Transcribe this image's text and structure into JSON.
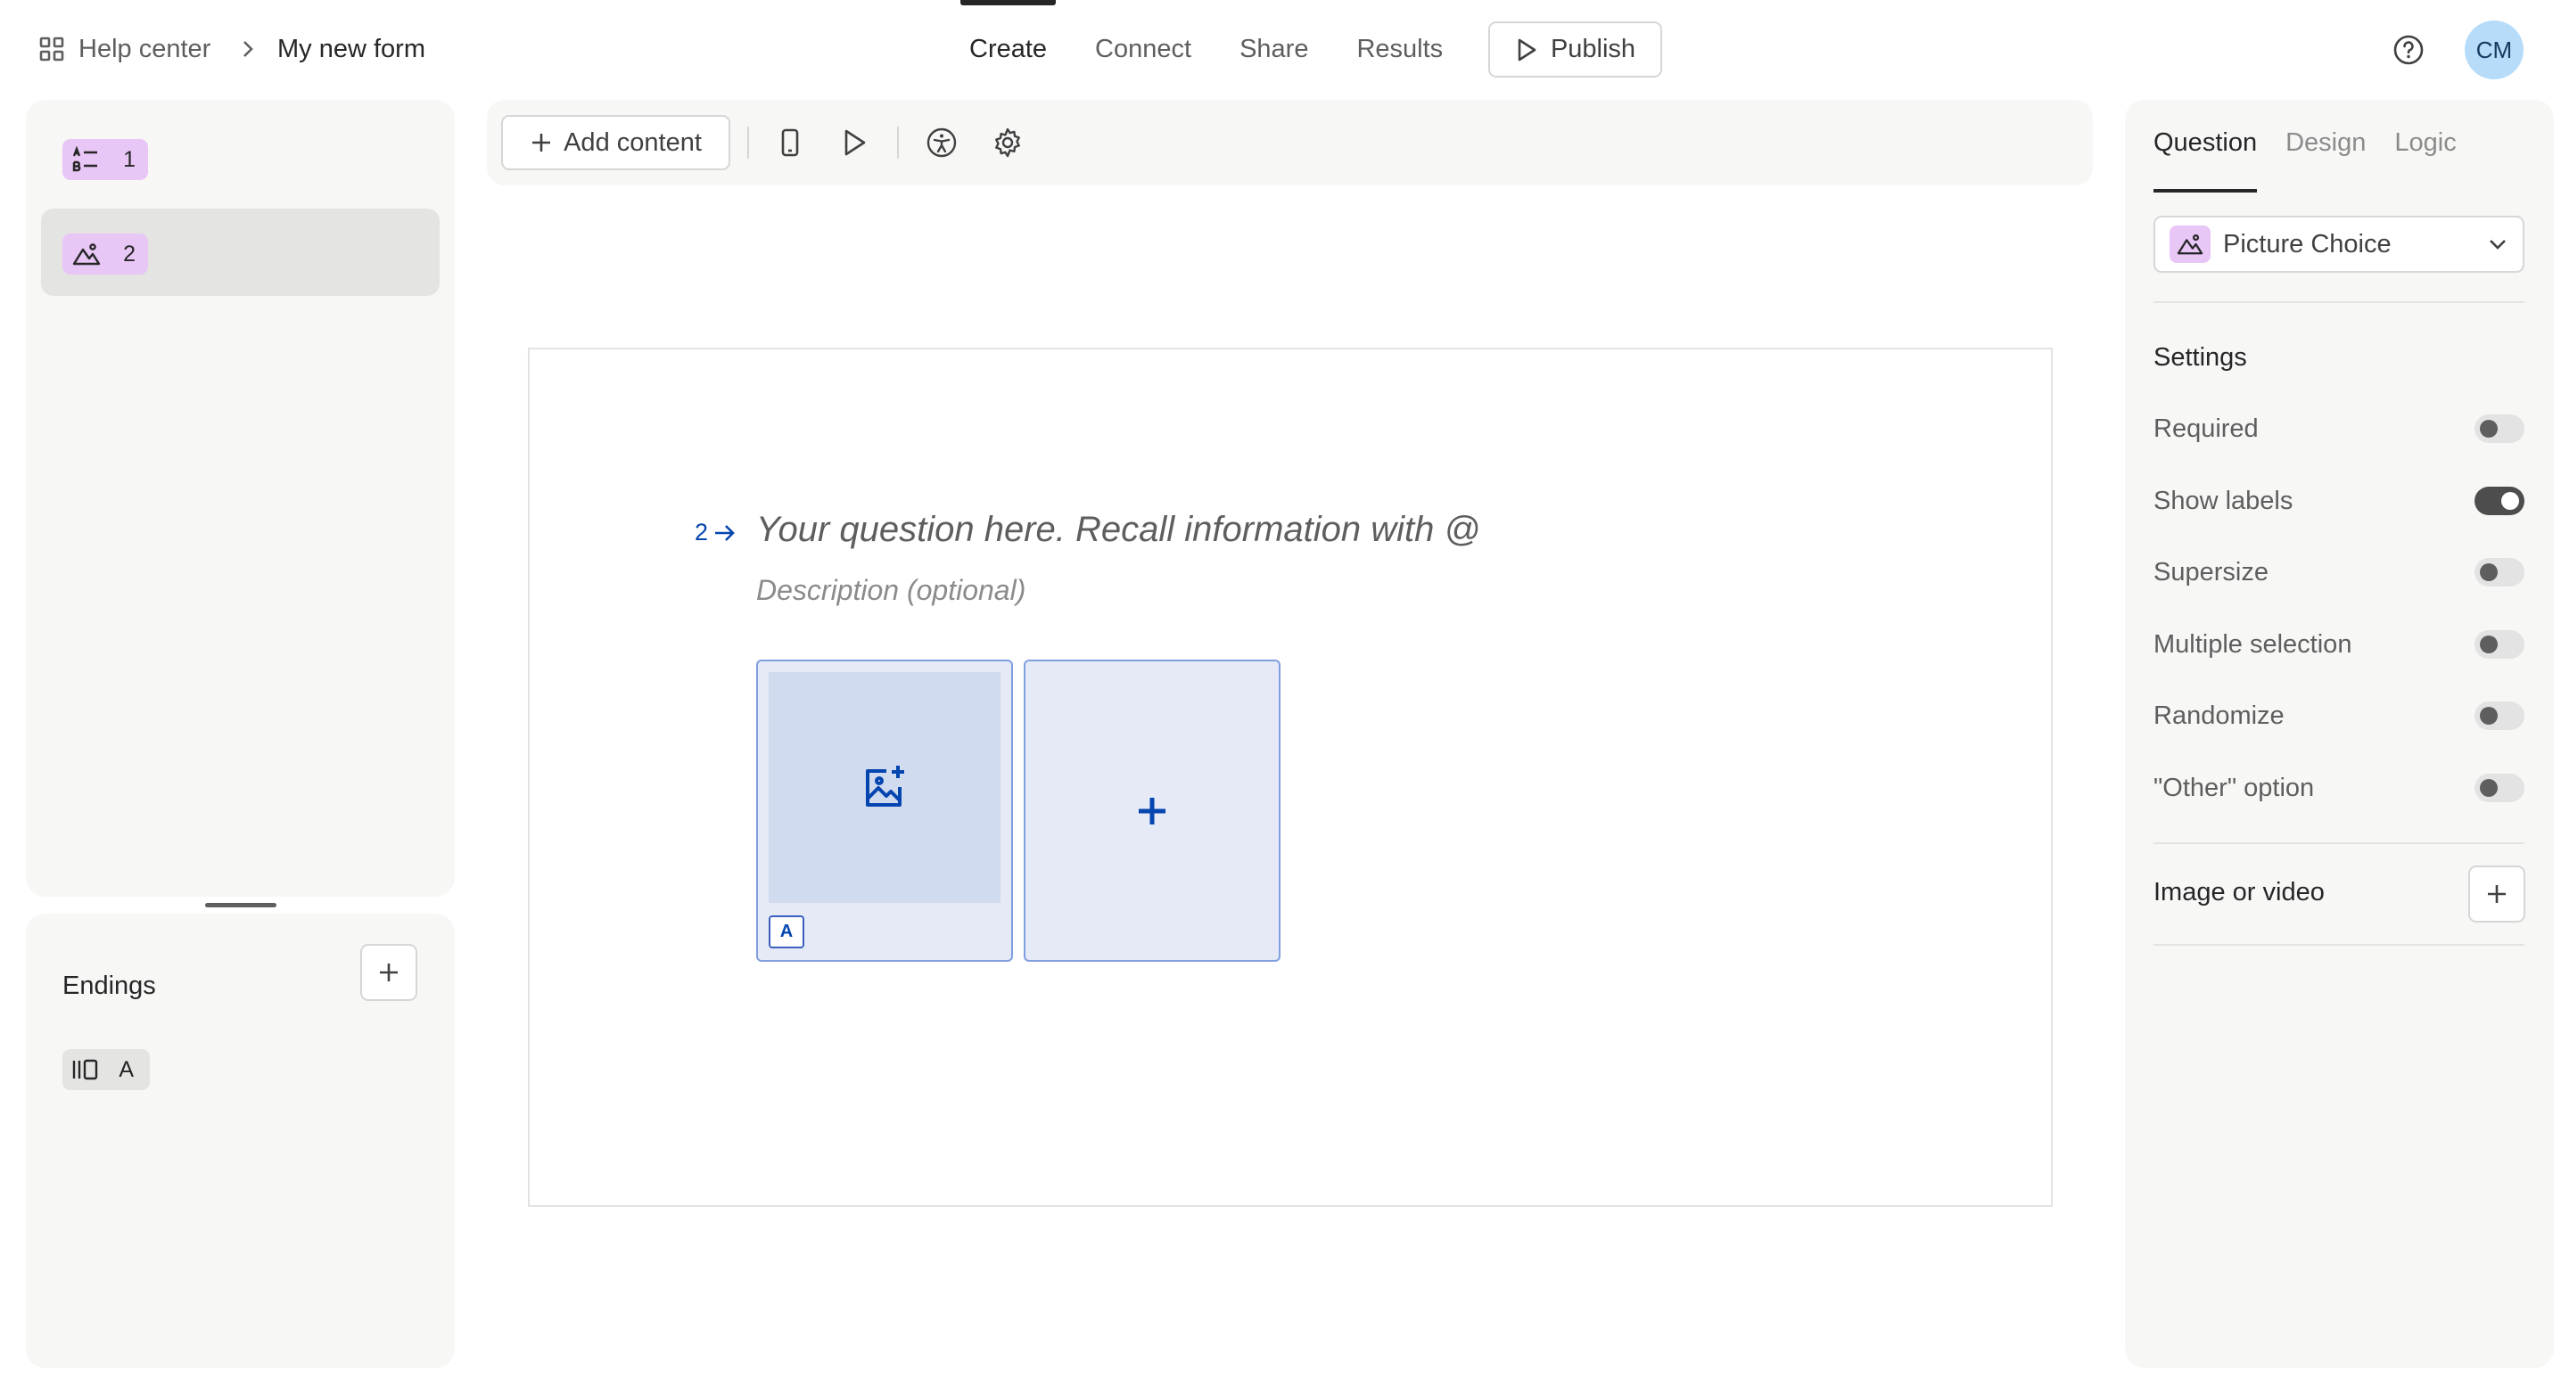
{
  "header": {
    "breadcrumb_home": "Help center",
    "breadcrumb_form": "My new form",
    "nav_tabs": [
      {
        "label": "Create",
        "active": true
      },
      {
        "label": "Connect",
        "active": false
      },
      {
        "label": "Share",
        "active": false
      },
      {
        "label": "Results",
        "active": false
      }
    ],
    "publish_label": "Publish",
    "avatar_initials": "CM"
  },
  "questions_panel": {
    "items": [
      {
        "number": "1",
        "icon": "multiple-choice-icon",
        "selected": false
      },
      {
        "number": "2",
        "icon": "picture-choice-icon",
        "selected": true
      }
    ]
  },
  "endings_panel": {
    "title": "Endings",
    "items": [
      {
        "key": "A",
        "icon": "ending-icon"
      }
    ]
  },
  "toolbar": {
    "add_content_label": "Add content",
    "icons": [
      "mobile-preview-icon",
      "play-preview-icon",
      "accessibility-icon",
      "settings-gear-icon"
    ]
  },
  "canvas": {
    "question_number": "2",
    "question_placeholder": "Your question here. Recall information with @",
    "description_placeholder": "Description (optional)",
    "choices": [
      {
        "key": "A"
      }
    ]
  },
  "right_panel": {
    "tabs": [
      {
        "label": "Question",
        "active": true
      },
      {
        "label": "Design",
        "active": false
      },
      {
        "label": "Logic",
        "active": false
      }
    ],
    "question_type": "Picture Choice",
    "settings_title": "Settings",
    "settings": [
      {
        "label": "Required",
        "on": false
      },
      {
        "label": "Show labels",
        "on": true
      },
      {
        "label": "Supersize",
        "on": false
      },
      {
        "label": "Multiple selection",
        "on": false
      },
      {
        "label": "Randomize",
        "on": false
      },
      {
        "label": "\"Other\" option",
        "on": false
      }
    ],
    "media_title": "Image or video"
  },
  "colors": {
    "accent_blue": "#0445af",
    "question_badge": "#e8c6f5",
    "choice_fill": "#e6eaf7",
    "choice_border": "#7f9fe0"
  }
}
